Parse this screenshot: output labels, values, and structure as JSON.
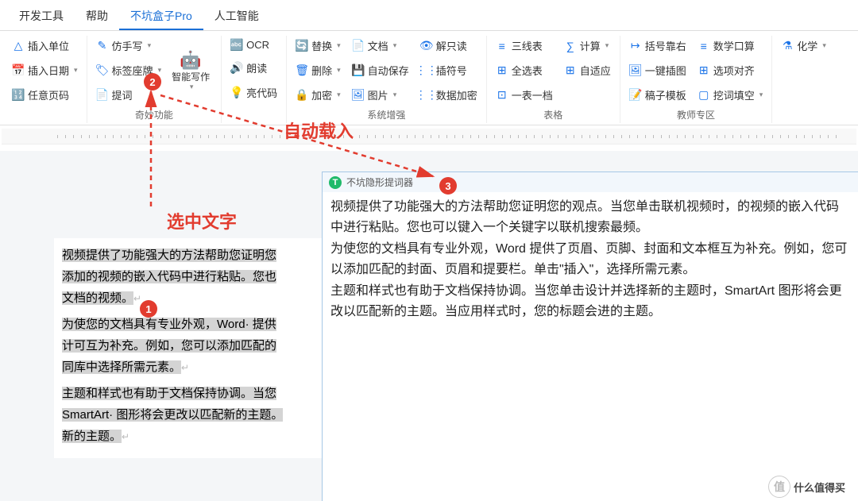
{
  "menubar": [
    "开发工具",
    "帮助",
    "不坑盒子Pro",
    "人工智能"
  ],
  "menubar_active_index": 2,
  "ribbon": {
    "group1": {
      "btns": [
        {
          "icon": "△",
          "label": "插入单位"
        },
        {
          "icon": "📅",
          "label": "插入日期",
          "dd": true
        },
        {
          "icon": "🔢",
          "label": "任意页码"
        }
      ]
    },
    "group2": {
      "label": "奇妙功能",
      "col1": [
        {
          "icon": "✎",
          "label": "仿手写",
          "dd": true
        },
        {
          "icon": "🏷",
          "label": "标签座牌",
          "dd": true
        },
        {
          "icon": "📄",
          "label": "提词"
        }
      ],
      "big": {
        "icon": "🤖",
        "label": "智能写作",
        "dd": true
      }
    },
    "group3": {
      "btns": [
        {
          "icon": "🔤",
          "label": "OCR"
        },
        {
          "icon": "🔊",
          "label": "朗读"
        },
        {
          "icon": "💡",
          "label": "亮代码"
        }
      ]
    },
    "group4": {
      "label": "系统增强",
      "col1": [
        {
          "icon": "🔄",
          "label": "替换",
          "dd": true
        },
        {
          "icon": "🗑",
          "label": "删除",
          "dd": true
        },
        {
          "icon": "🔒",
          "label": "加密",
          "dd": true
        }
      ],
      "col2": [
        {
          "icon": "📄",
          "label": "文档",
          "dd": true
        },
        {
          "icon": "💾",
          "label": "自动保存"
        },
        {
          "icon": "🖼",
          "label": "图片",
          "dd": true
        }
      ],
      "col3": [
        {
          "icon": "👁",
          "label": "解只读"
        },
        {
          "icon": "⋮⋮",
          "label": "插符号"
        },
        {
          "icon": "⋮⋮",
          "label": "数据加密"
        }
      ]
    },
    "group5": {
      "label": "表格",
      "col1": [
        {
          "icon": "≡",
          "label": "三线表"
        },
        {
          "icon": "⊞",
          "label": "全选表"
        },
        {
          "icon": "⊡",
          "label": "一表一档"
        }
      ],
      "col2": [
        {
          "icon": "∑",
          "label": "计算",
          "dd": true
        },
        {
          "icon": "⊞",
          "label": "自适应"
        }
      ]
    },
    "group6": {
      "label": "教师专区",
      "col1": [
        {
          "icon": "↦",
          "label": "括号靠右"
        },
        {
          "icon": "🖼",
          "label": "一键插图"
        },
        {
          "icon": "📝",
          "label": "稿子模板"
        }
      ],
      "col2": [
        {
          "icon": "≡",
          "label": "数学口算"
        },
        {
          "icon": "⊞",
          "label": "选项对齐"
        },
        {
          "icon": "▢",
          "label": "挖词填空",
          "dd": true
        }
      ]
    },
    "group7": {
      "btns": [
        {
          "icon": "⚗",
          "label": "化学",
          "dd": true
        }
      ]
    }
  },
  "annotations": {
    "auto_load": "自动载入",
    "select_text": "选中文字",
    "badge1": "1",
    "badge2": "2",
    "badge3": "3"
  },
  "document": {
    "p1a": "视频提供了功能强大的方法帮助您证明您",
    "p1b": "添加的视频的嵌入代码中进行粘贴。您也",
    "p1c": "文档的视频。",
    "p2a": "为使您的文档具有专业外观，Word· 提供",
    "p2b": "计可互为补充。例如，您可以添加匹配的",
    "p2c": "同库中选择所需元素。",
    "p3a": "主题和样式也有助于文档保持协调。当您",
    "p3b": "SmartArt· 图形将会更改以匹配新的主题。",
    "p3c": "新的主题。"
  },
  "panel": {
    "title": "不坑隐形提词器",
    "body_p1": "视频提供了功能强大的方法帮助您证明您的观点。当您单击联机视频时，的视频的嵌入代码中进行粘贴。您也可以键入一个关键字以联机搜索最频。",
    "body_p2": "为使您的文档具有专业外观，Word 提供了页眉、页脚、封面和文本框互为补充。例如，您可以添加匹配的封面、页眉和提要栏。单击\"插入\"，选择所需元素。",
    "body_p3": "主题和样式也有助于文档保持协调。当您单击设计并选择新的主题时，SmartArt 图形将会更改以匹配新的主题。当应用样式时，您的标题会进的主题。"
  },
  "watermark": "什么值得买"
}
